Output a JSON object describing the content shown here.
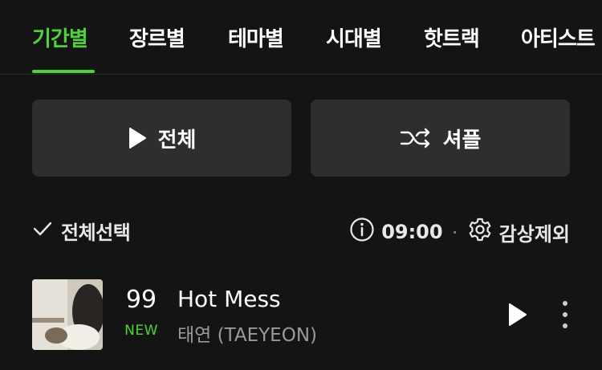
{
  "tabs": [
    {
      "label": "기간별",
      "active": true
    },
    {
      "label": "장르별",
      "active": false
    },
    {
      "label": "테마별",
      "active": false
    },
    {
      "label": "시대별",
      "active": false
    },
    {
      "label": "핫트랙",
      "active": false
    },
    {
      "label": "아티스트",
      "active": false
    }
  ],
  "actions": {
    "play_all_label": "전체",
    "shuffle_label": "셔플"
  },
  "toolbar": {
    "select_all_label": "전체선택",
    "timer_value": "09:00",
    "exclude_label": "감상제외"
  },
  "songs": [
    {
      "rank": "99",
      "badge": "NEW",
      "title": "Hot Mess",
      "artist": "태연 (TAEYEON)"
    }
  ],
  "colors": {
    "accent": "#4fd13a",
    "background": "#141414",
    "button": "#2e2e2e"
  },
  "icons": [
    "play-icon",
    "shuffle-icon",
    "check-icon",
    "info-icon",
    "gear-icon",
    "more-vertical-icon"
  ]
}
